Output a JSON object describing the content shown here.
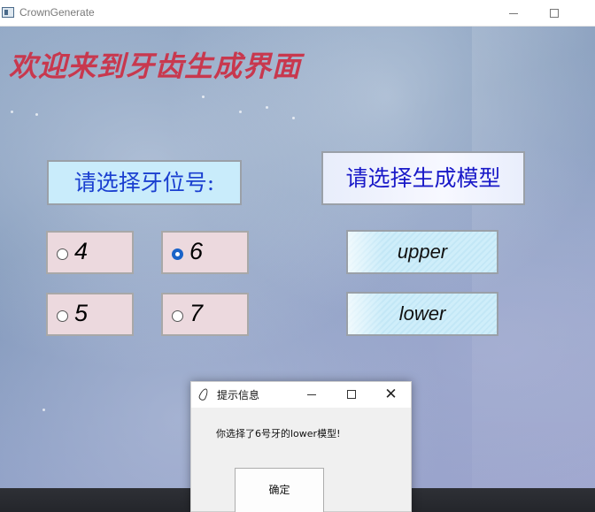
{
  "window": {
    "title": "CrownGenerate",
    "minimize_glyph": "",
    "maximize_glyph": ""
  },
  "main": {
    "welcome_text": "欢迎来到牙齿生成界面",
    "welcome_color": "#c8384e",
    "tooth_label": "请选择牙位号:",
    "model_label": "请选择生成模型",
    "tooth_options": [
      {
        "value": "4",
        "checked": false
      },
      {
        "value": "6",
        "checked": true
      },
      {
        "value": "5",
        "checked": false
      },
      {
        "value": "7",
        "checked": false
      }
    ],
    "model_buttons": {
      "upper": "upper",
      "lower": "lower"
    }
  },
  "dialog": {
    "title": "提示信息",
    "message": "你选择了6号牙的lower模型!",
    "ok_label": "确定",
    "close_glyph": "✕"
  },
  "colors": {
    "radio_checked": "#1a63c8",
    "label_tooth_bg": "#c9ecfb",
    "label_text": "#1a3fd0",
    "radio_bg": "#ecd9de"
  }
}
